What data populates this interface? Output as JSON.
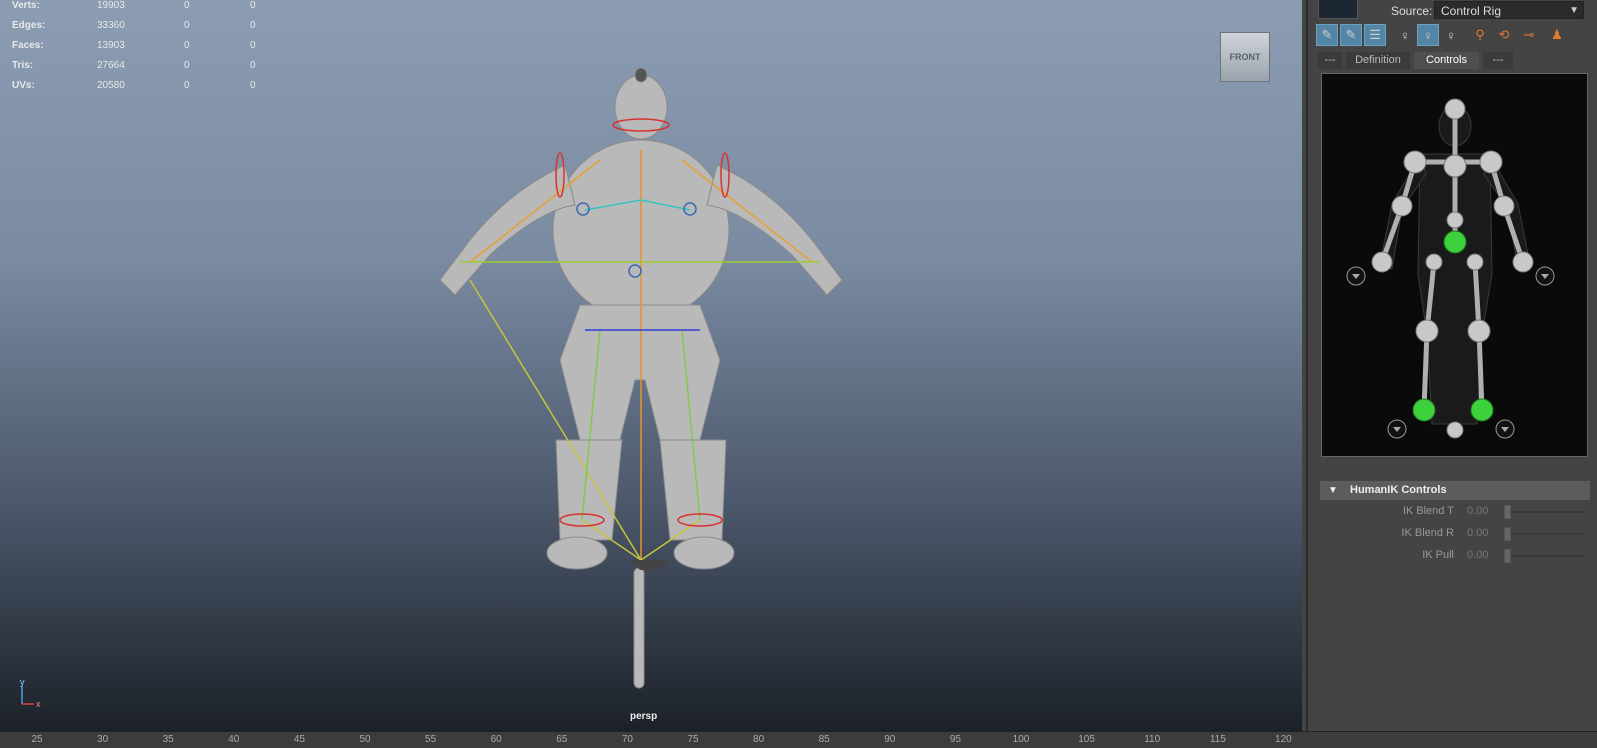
{
  "hud": {
    "rows": [
      {
        "label": "Verts:",
        "v1": "19903",
        "v2": "0",
        "v3": "0"
      },
      {
        "label": "Edges:",
        "v1": "33360",
        "v2": "0",
        "v3": "0"
      },
      {
        "label": "Faces:",
        "v1": "13903",
        "v2": "0",
        "v3": "0"
      },
      {
        "label": "Tris:",
        "v1": "27664",
        "v2": "0",
        "v3": "0"
      },
      {
        "label": "UVs:",
        "v1": "20580",
        "v2": "0",
        "v3": "0"
      }
    ]
  },
  "viewport": {
    "viewcube_label": "FRONT",
    "camera_label": "persp",
    "axis_y": "y",
    "axis_x": "x"
  },
  "timeline": {
    "ticks": [
      "25",
      "30",
      "35",
      "40",
      "45",
      "50",
      "55",
      "60",
      "65",
      "70",
      "75",
      "80",
      "85",
      "90",
      "95",
      "100",
      "105",
      "110",
      "115",
      "120"
    ]
  },
  "panel": {
    "source_label": "Source:",
    "source_value": "Control Rig",
    "toolbar_icons": [
      "full-body-fk-icon",
      "body-part-icon",
      "skeleton-icon",
      "stance-pose-icon",
      "selected-pose-icon",
      "character-pose-icon",
      "pin-translate-icon",
      "pin-rotate-icon",
      "release-pin-icon",
      "character-icon"
    ],
    "tabs": [
      "---",
      "Definition",
      "Controls",
      "---"
    ],
    "active_tab": "Controls",
    "section_title": "HumanIK Controls",
    "sliders": [
      {
        "label": "IK Blend T",
        "value": "0.00",
        "level": 0
      },
      {
        "label": "IK Blend R",
        "value": "0.00",
        "level": 0
      },
      {
        "label": "IK Pull",
        "value": "0.00",
        "level": 0
      }
    ]
  },
  "colors": {
    "viewport_top": "#8b9cb3",
    "viewport_bottom": "#1c2128",
    "active_tool": "#5285a6",
    "control_green": "#3dd13d",
    "accent_orange": "#e07a2e"
  }
}
